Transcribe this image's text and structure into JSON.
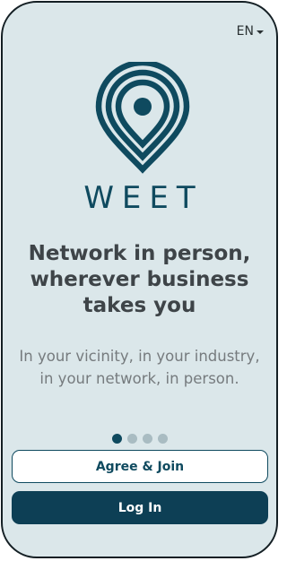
{
  "language_selector": {
    "label": "EN",
    "icon": "chevron-down-icon"
  },
  "logo": {
    "icon": "location-pin-icon",
    "wordmark": "WEET"
  },
  "onboarding": {
    "headline_lines": [
      "Network in person,",
      "wherever business",
      "takes you"
    ],
    "subhead_lines": [
      "In your vicinity, in your industry,",
      "in your network, in person."
    ],
    "pager": {
      "total_pages": 4,
      "current_page": 1
    }
  },
  "actions": {
    "join_label": "Agree & Join",
    "login_label": "Log In"
  },
  "colors": {
    "background": "#dbe7ea",
    "brand": "#0f4a5f",
    "primary_button": "#0d3f55",
    "headline_text": "#3e4448",
    "body_text": "#767b7e"
  }
}
